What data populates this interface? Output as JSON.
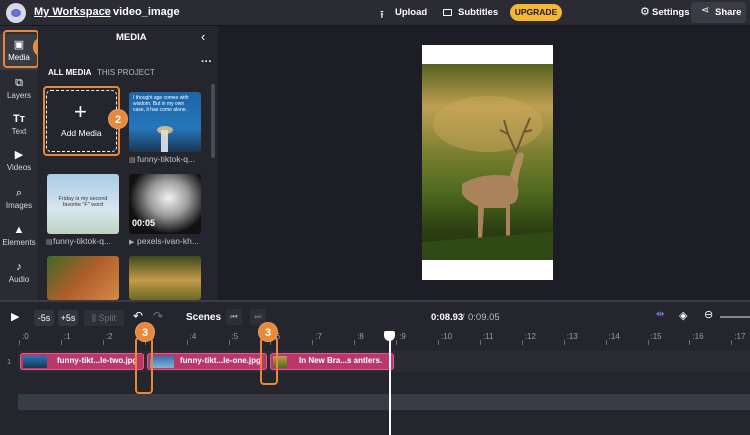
{
  "topbar": {
    "workspace": "My Workspace",
    "separator": "›",
    "project_name": "video_image",
    "upload_label": "Upload",
    "subtitles_label": "Subtitles",
    "upgrade_label": "UPGRADE",
    "settings_label": "Settings",
    "share_label": "Share"
  },
  "sidebar": {
    "items": [
      {
        "label": "Media",
        "icon": "media-icon"
      },
      {
        "label": "Layers",
        "icon": "layers-icon"
      },
      {
        "label": "Text",
        "icon": "text-icon"
      },
      {
        "label": "Videos",
        "icon": "videos-icon"
      },
      {
        "label": "Images",
        "icon": "images-icon"
      },
      {
        "label": "Elements",
        "icon": "elements-icon"
      },
      {
        "label": "Audio",
        "icon": "audio-icon"
      }
    ]
  },
  "media_panel": {
    "title": "MEDIA",
    "tabs": [
      "ALL MEDIA",
      "THIS PROJECT"
    ],
    "add_media_label": "Add Media",
    "add_media_icon": "+",
    "items": [
      {
        "label": "funny-tiktok-q...",
        "overlay_text": "I thought age comes with wisdom. But in my own case, it has come alone."
      },
      {
        "label": "funny-tiktok-q...",
        "overlay_text": "Friday is my second favorite \"F\" word"
      },
      {
        "label": "pexels-ivan-kh...",
        "duration": "00:05"
      },
      {
        "label": "",
        "overlay_text": ""
      },
      {
        "label": "",
        "overlay_text": ""
      }
    ]
  },
  "callouts": {
    "one": "1",
    "two": "2",
    "three_a": "3",
    "three_b": "3"
  },
  "timeline": {
    "minus5": "-5s",
    "plus5": "+5s",
    "split_label": "Split",
    "scenes_label": "Scenes",
    "current_time": "0:08.93",
    "separator": "/",
    "total_time": "0:09.05",
    "track_number": "1",
    "ticks": [
      ":0",
      ":1",
      ":2",
      ":3",
      ":4",
      ":5",
      ":6",
      ":7",
      ":8",
      ":9",
      ":10",
      ":11",
      ":12",
      ":13",
      ":14",
      ":15",
      ":16",
      ":17"
    ],
    "clips": [
      {
        "label": "funny-tikt...le-two.jpg"
      },
      {
        "label": "funny-tikt...le-one.jpg"
      },
      {
        "label": "In New Bra...s antlers."
      }
    ]
  },
  "colors": {
    "accent": "#e8883a",
    "upgrade": "#f5b731",
    "clip": "#b8386a",
    "playhead": "#ffffff"
  }
}
